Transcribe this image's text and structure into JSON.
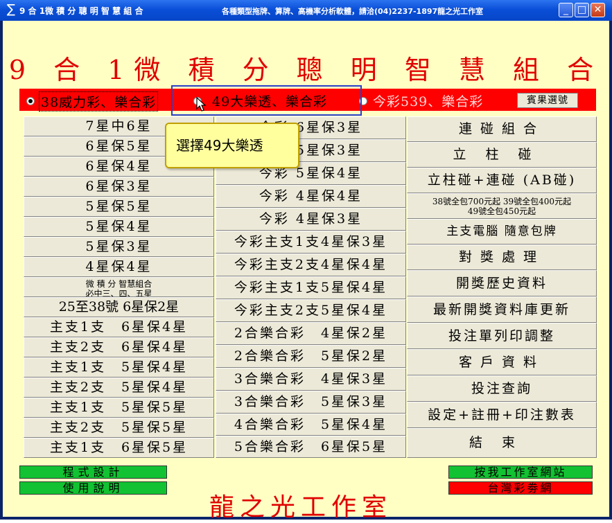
{
  "window": {
    "title": "9 合 1微 積 分 聰 明 智 慧 組 合",
    "info": "各種類型拖牌、算牌、高機率分析軟體，請洽(04)2237-1897龍之光工作室",
    "minimize": "_",
    "maximize": "□",
    "close": "✕"
  },
  "header": {
    "main_title": "9 合 1微 積 分 聰 明 智 慧 組 合"
  },
  "lottery_select": {
    "options": [
      "38威力彩、樂合彩",
      "49大樂透、樂合彩",
      "今彩539、樂合彩"
    ],
    "selected": 0,
    "result_button": "賓果選號"
  },
  "tooltip": {
    "text": "選擇49大樂透"
  },
  "col1": [
    "7星中6星",
    "6星保5星",
    "6星保4星",
    "6星保3星",
    "5星保5星",
    "5星保4星",
    "5星保3星",
    "4星保4星",
    "25至38號 6星保2星",
    "主支1支　6星保4星",
    "主支2支　6星保4星",
    "主支1支　5星保4星",
    "主支2支　5星保4星",
    "主支1支　5星保5星",
    "主支2支　5星保5星",
    "主支1支　6星保5星"
  ],
  "col1_special": {
    "line1": "微 積 分 智慧組合",
    "line2": "必中三、四、五星"
  },
  "col2": [
    "今彩 6星保3星",
    "今彩 5星保3星",
    "今彩 5星保4星",
    "今彩 4星保4星",
    "今彩 4星保3星",
    "今彩主支1支4星保3星",
    "今彩主支2支4星保4星",
    "今彩主支1支5星保4星",
    "今彩主支2支5星保4星",
    "2合樂合彩　4星保2星",
    "2合樂合彩　5星保2星",
    "3合樂合彩　4星保3星",
    "3合樂合彩　5星保3星",
    "4合樂合彩　5星保4星",
    "5合樂合彩　6星保5星"
  ],
  "col3": {
    "lianpeng": "連碰組合",
    "lizhu": "立柱碰",
    "ab": "立柱碰+連碰 (AB碰)",
    "note1": "38號全包700元起 39號全包400元起",
    "note2": "49號全包450元起",
    "computer": "主支電腦 隨意包牌",
    "prize": "對獎處理",
    "history": "開獎歷史資料",
    "update": "最新開獎資料庫更新",
    "print": "投注單列印調整",
    "customer": "客戶資料",
    "query": "投注查詢",
    "settings": "設定+註冊+印注數表",
    "exit": "結束"
  },
  "footer": {
    "design": "程式設計",
    "manual": "使用說明",
    "studio": "龍之光工作室",
    "website": "按我工作室網站",
    "lottery_net": "台灣彩劵網"
  },
  "colors": {
    "accent_red": "#ff0000",
    "bg": "#ffffc4",
    "green": "#12c232"
  }
}
